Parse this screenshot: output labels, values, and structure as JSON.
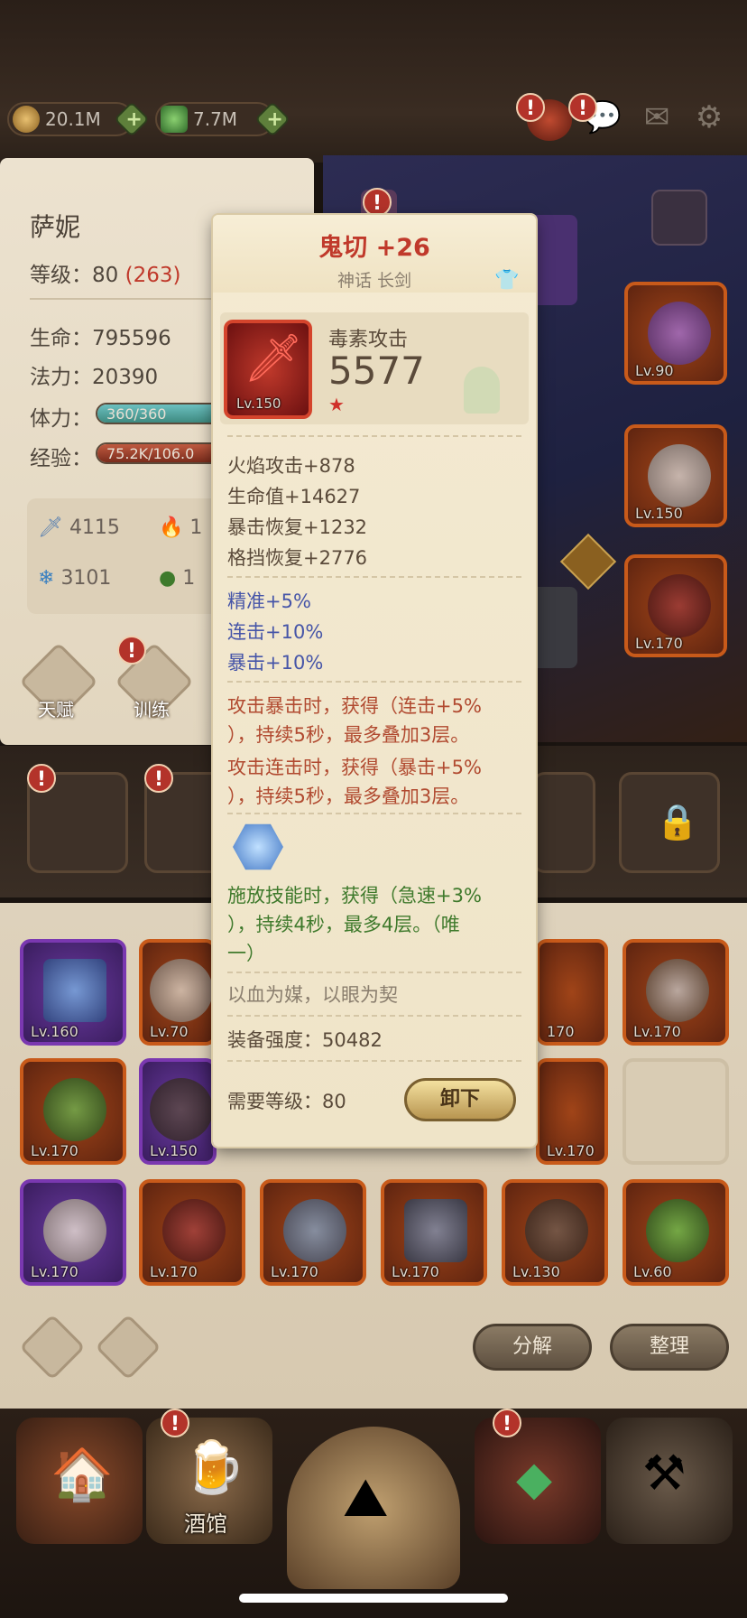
{
  "resources": {
    "gold": "20.1M",
    "gems": "7.7M"
  },
  "hero": {
    "name": "萨妮",
    "level_label": "等级：",
    "level_value": "80",
    "level_extra": "(263)",
    "hp_label": "生命：",
    "hp_value": "795596",
    "mp_label": "法力：",
    "mp_value": "20390",
    "stamina_label": "体力：",
    "stamina_text": "360/360",
    "stamina_fill": 1.0,
    "exp_label": "经验：",
    "exp_text": "75.2K/106.0",
    "exp_fill": 0.7,
    "stat_attack": "4115",
    "stat_fire": "1",
    "stat_ice": "3101",
    "stat_poison": "1",
    "skill_talent": "天赋",
    "skill_train": "训练"
  },
  "tooltip": {
    "title": "鬼切 +26",
    "subtitle": "神话 长剑",
    "item_level": "Lv.150",
    "main_attr_name": "毒素攻击",
    "main_attr_value": "5577",
    "stats": [
      "火焰攻击+878",
      "生命值+14627",
      "暴击恢复+1232",
      "格挡恢复+2776"
    ],
    "bonus": [
      "精准+5%",
      "连击+10%",
      "暴击+10%"
    ],
    "effects": [
      [
        "攻击暴击时，获得（连击+5%",
        "），持续5秒，最多叠加3层。"
      ],
      [
        "攻击连击时，获得（暴击+5%",
        "），持续5秒，最多叠加3层。"
      ]
    ],
    "gem_effect": [
      "施放技能时，获得（急速+3%",
      "），持续4秒，最多4层。（唯",
      "一）"
    ],
    "flavor": "以血为媒，以眼为契",
    "power_label": "装备强度：",
    "power_value": "50482",
    "req_label": "需要等级：",
    "req_value": "80",
    "unequip_label": "卸下"
  },
  "scene_equipment": [
    "Lv.90",
    "Lv.150",
    "Lv.170"
  ],
  "inventory": {
    "row1": [
      "Lv.160",
      "Lv.70",
      "",
      "",
      "170",
      "Lv.170"
    ],
    "row2": [
      "Lv.170",
      "Lv.150",
      "",
      "",
      "Lv.170",
      ""
    ],
    "row3": [
      "Lv.170",
      "Lv.170",
      "Lv.170",
      "Lv.170",
      "Lv.130",
      "Lv.60"
    ],
    "decompose_label": "分解",
    "sort_label": "整理"
  },
  "nav": {
    "tavern_label": "酒馆"
  },
  "colors": {
    "orange_frame": "#c85a1a",
    "purple_frame": "#7a38b0",
    "title_red": "#c0392b",
    "bonus_blue": "#4655a8",
    "effect_red": "#b14a30",
    "gem_green": "#3f7a2c"
  }
}
